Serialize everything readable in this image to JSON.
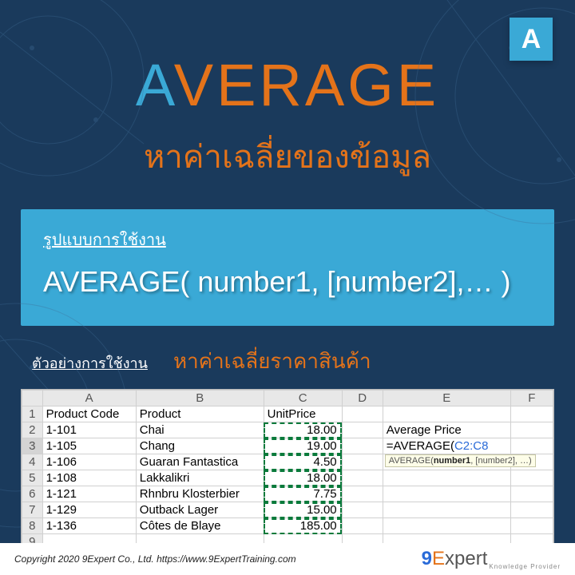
{
  "badge": "A",
  "hero": {
    "title_accent": "A",
    "title_rest": "VERAGE",
    "subtitle": "หาค่าเฉลี่ยของข้อมูล"
  },
  "syntax": {
    "label": "รูปแบบการใช้งาน",
    "text": "AVERAGE( number1, [number2],… )"
  },
  "example": {
    "label": "ตัวอย่างการใช้งาน",
    "desc": "หาค่าเฉลี่ยราคาสินค้า"
  },
  "sheet": {
    "cols": [
      "A",
      "B",
      "C",
      "D",
      "E",
      "F"
    ],
    "headers": {
      "A": "Product Code",
      "B": "Product",
      "C": "UnitPrice",
      "E2": "Average Price"
    },
    "rows": [
      {
        "n": 1,
        "A": "Product Code",
        "B": "Product",
        "C": "UnitPrice",
        "D": "",
        "E": "",
        "F": ""
      },
      {
        "n": 2,
        "A": "1-101",
        "B": "Chai",
        "C": "18.00",
        "D": "",
        "E": "Average Price",
        "F": ""
      },
      {
        "n": 3,
        "A": "1-105",
        "B": "Chang",
        "C": "19.00",
        "D": "",
        "E": "=AVERAGE(C2:C8",
        "F": ""
      },
      {
        "n": 4,
        "A": "1-106",
        "B": "Guaran Fantastica",
        "C": "4.50",
        "D": "",
        "E": "",
        "F": ""
      },
      {
        "n": 5,
        "A": "1-108",
        "B": "Lakkalikri",
        "C": "18.00",
        "D": "",
        "E": "",
        "F": ""
      },
      {
        "n": 6,
        "A": "1-121",
        "B": "Rhnbru Klosterbier",
        "C": "7.75",
        "D": "",
        "E": "",
        "F": ""
      },
      {
        "n": 7,
        "A": "1-129",
        "B": "Outback Lager",
        "C": "15.00",
        "D": "",
        "E": "",
        "F": ""
      },
      {
        "n": 8,
        "A": "1-136",
        "B": "Côtes de Blaye",
        "C": "185.00",
        "D": "",
        "E": "",
        "F": ""
      },
      {
        "n": 9,
        "A": "",
        "B": "",
        "C": "",
        "D": "",
        "E": "",
        "F": ""
      }
    ],
    "formula": {
      "fn": "=AVERAGE(",
      "ref": "C2:C8"
    },
    "tooltip": {
      "fn": "AVERAGE(",
      "bold": "number1",
      "rest": ", [number2], …)"
    }
  },
  "footer": {
    "copy": "Copyright 2020 9Expert Co., Ltd.   https://www.9ExpertTraining.com",
    "logo": {
      "nine": "9",
      "e": "E",
      "xpert": "xpert",
      "sub": "Knowledge Provider"
    }
  }
}
